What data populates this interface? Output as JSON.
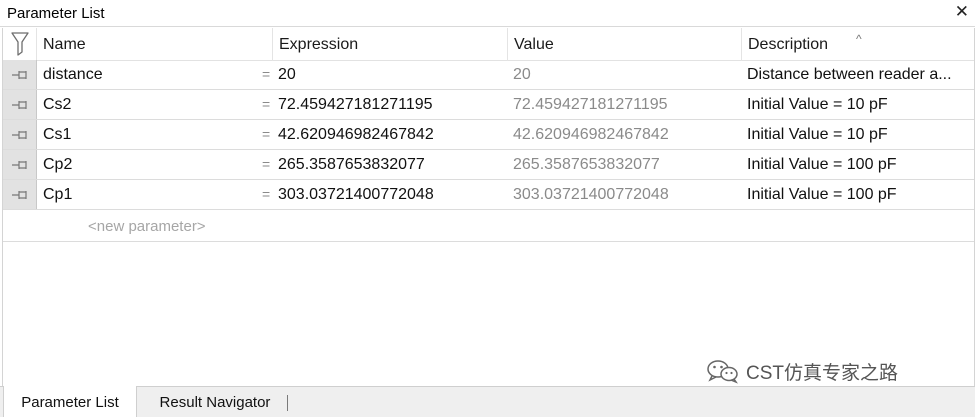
{
  "window": {
    "title": "Parameter List",
    "close_glyph": "✕"
  },
  "columns": [
    "Name",
    "Expression",
    "Value",
    "Description"
  ],
  "sort_indicator": "^",
  "rows": [
    {
      "name": "distance",
      "expression": "20",
      "value": "20",
      "description": "Distance between reader a..."
    },
    {
      "name": "Cs2",
      "expression": "72.459427181271195",
      "value": "72.459427181271195",
      "description": "Initial Value = 10 pF"
    },
    {
      "name": "Cs1",
      "expression": "42.620946982467842",
      "value": "42.620946982467842",
      "description": "Initial Value = 10 pF"
    },
    {
      "name": "Cp2",
      "expression": "265.3587653832077",
      "value": "265.3587653832077",
      "description": "Initial Value = 100 pF"
    },
    {
      "name": "Cp1",
      "expression": "303.03721400772048",
      "value": "303.03721400772048",
      "description": "Initial Value = 100 pF"
    }
  ],
  "equals_sign": "=",
  "new_parameter_placeholder": "<new parameter>",
  "tabs": [
    {
      "label": "Parameter List",
      "active": true
    },
    {
      "label": "Result Navigator",
      "active": false
    }
  ],
  "watermark": {
    "text": "CST仿真专家之路",
    "icon": "wechat-icon"
  },
  "icons": {
    "filter": "filter-icon",
    "row_pin": "pin-icon"
  }
}
